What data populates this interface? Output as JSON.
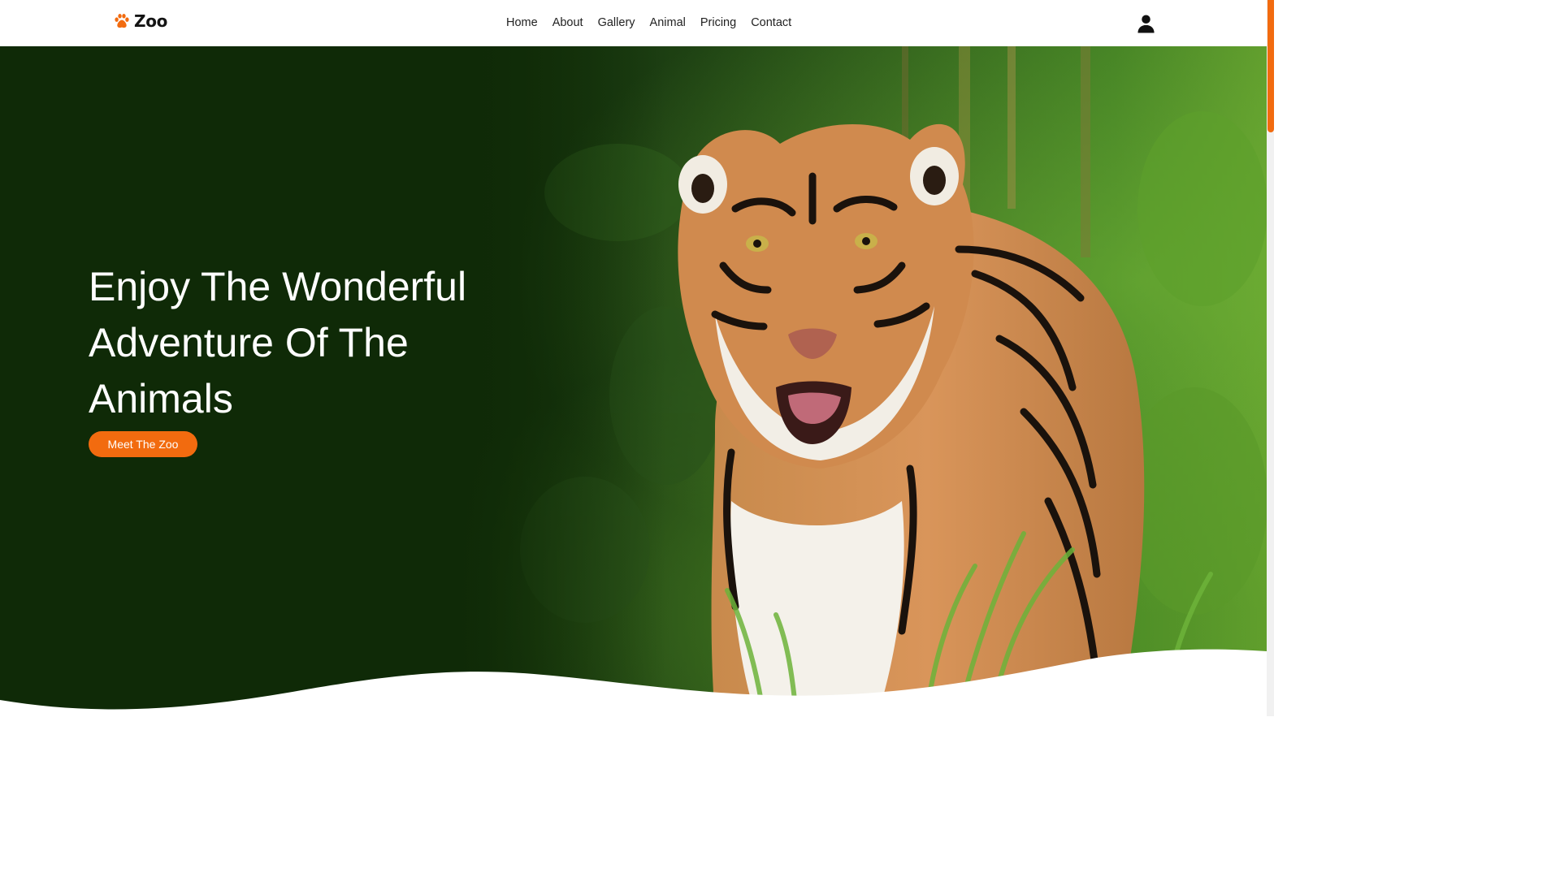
{
  "brand": {
    "name": "Zoo",
    "icon": "paw-icon",
    "accent_color": "#f26b0f"
  },
  "nav": {
    "items": [
      {
        "label": "Home"
      },
      {
        "label": "About"
      },
      {
        "label": "Gallery"
      },
      {
        "label": "Animal"
      },
      {
        "label": "Pricing"
      },
      {
        "label": "Contact"
      }
    ],
    "user_icon": "user-icon"
  },
  "hero": {
    "title_lines": [
      "Enjoy The Wonderful",
      "Adventure Of The",
      "Animals"
    ],
    "button_label": "Meet The Zoo",
    "background_color": "#0f2a07",
    "image_subject": "tiger-image"
  },
  "colors": {
    "accent": "#f26b0f",
    "hero_dark_green": "#0f2a07",
    "text_dark": "#222222"
  }
}
